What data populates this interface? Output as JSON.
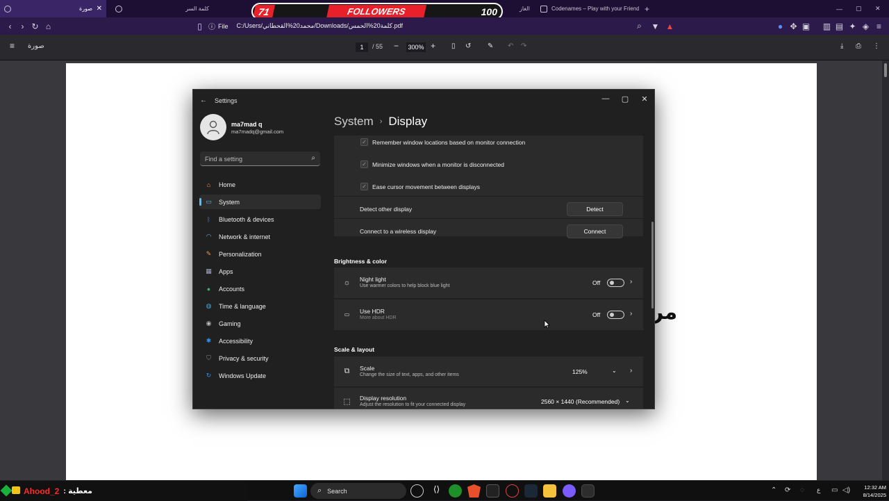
{
  "browser": {
    "tabs": [
      {
        "label": "صورة",
        "active": true
      },
      {
        "label": "كلمة السر",
        "active": false
      },
      {
        "label": "الغاز",
        "active": false
      },
      {
        "label": "Codenames – Play with your Friends",
        "active": false
      }
    ],
    "new_tab": "+",
    "file_label": "File",
    "url": "C:/Users/محمد20%القحطاني/Downloads/كلمة20%الحمس.pdf"
  },
  "overlay": {
    "followers_left": "71",
    "followers_label": "FOLLOWERS",
    "followers_right": "100"
  },
  "pdf": {
    "doc_title": "صورة",
    "page_current": "1",
    "page_total": "/ 55",
    "zoom": "300%",
    "page_fragment": "مر"
  },
  "settings": {
    "title": "Settings",
    "user_name": "ma7mad q",
    "user_email": "ma7madq@gmail.com",
    "search_placeholder": "Find a setting",
    "nav": [
      {
        "label": "Home",
        "icon": "home-icon",
        "color": "#e8a25b"
      },
      {
        "label": "System",
        "icon": "system-icon",
        "color": "#4cc2ff"
      },
      {
        "label": "Bluetooth & devices",
        "icon": "bluetooth-icon",
        "color": "#2f7fe0"
      },
      {
        "label": "Network & internet",
        "icon": "wifi-icon",
        "color": "#5cb8f2"
      },
      {
        "label": "Personalization",
        "icon": "brush-icon",
        "color": "#e8984c"
      },
      {
        "label": "Apps",
        "icon": "apps-icon",
        "color": "#a4a4c8"
      },
      {
        "label": "Accounts",
        "icon": "person-icon",
        "color": "#35b270"
      },
      {
        "label": "Time & language",
        "icon": "globe-icon",
        "color": "#3aa6e0"
      },
      {
        "label": "Gaming",
        "icon": "controller-icon",
        "color": "#b8b8b8"
      },
      {
        "label": "Accessibility",
        "icon": "accessibility-icon",
        "color": "#3b8de0"
      },
      {
        "label": "Privacy & security",
        "icon": "shield-icon",
        "color": "#8a8a8a"
      },
      {
        "label": "Windows Update",
        "icon": "update-icon",
        "color": "#2f8fe0"
      }
    ],
    "breadcrumb_parent": "System",
    "breadcrumb_sep": "›",
    "breadcrumb_current": "Display",
    "options": {
      "remember_windows": "Remember window locations based on monitor connection",
      "minimize_windows": "Minimize windows when a monitor is disconnected",
      "ease_cursor": "Ease cursor movement between displays",
      "detect_label": "Detect other display",
      "detect_button": "Detect",
      "connect_label": "Connect to a wireless display",
      "connect_button": "Connect"
    },
    "brightness_section": "Brightness & color",
    "night_light": {
      "title": "Night light",
      "desc": "Use warmer colors to help block blue light",
      "state": "Off"
    },
    "hdr": {
      "title": "Use HDR",
      "desc": "More about HDR",
      "state": "Off"
    },
    "scale_section": "Scale & layout",
    "scale": {
      "title": "Scale",
      "desc": "Change the size of text, apps, and other items",
      "value": "125%"
    },
    "resolution": {
      "title": "Display resolution",
      "desc": "Adjust the resolution to fit your connected display",
      "value": "2560 × 1440 (Recommended)"
    }
  },
  "taskbar": {
    "ticker_name": "Ahood_2",
    "ticker_label": ": معطية",
    "search_label": "Search",
    "lang": "ع",
    "time": "12:32 AM",
    "date": "8/14/2025"
  }
}
